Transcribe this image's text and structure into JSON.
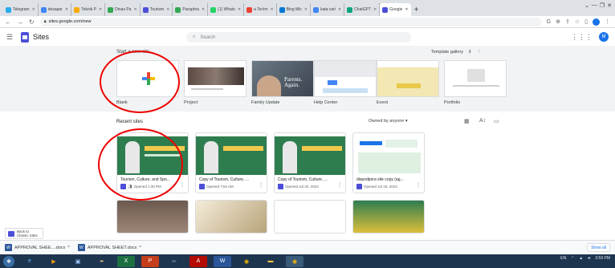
{
  "browser": {
    "tabs": [
      {
        "label": "Telegram",
        "color": "#2aabee"
      },
      {
        "label": "desapar",
        "color": "#4285f4"
      },
      {
        "label": "Teknik P",
        "color": "#f9ab00"
      },
      {
        "label": "Dinas Pa",
        "color": "#34a853"
      },
      {
        "label": "Tourism",
        "color": "#4c4ed8"
      },
      {
        "label": "Paraphra",
        "color": "#34a853"
      },
      {
        "label": "(1) Whats",
        "color": "#25d366"
      },
      {
        "label": "a Techn",
        "color": "#ea4335"
      },
      {
        "label": "Bing Mic",
        "color": "#0078d4"
      },
      {
        "label": "kata vari",
        "color": "#4285f4"
      },
      {
        "label": "ChatGPT",
        "color": "#10a37f"
      },
      {
        "label": "Google",
        "color": "#4c4ed8",
        "active": true
      }
    ],
    "url": "sites.google.com/new"
  },
  "header": {
    "app_title": "Sites",
    "search_placeholder": "Search",
    "avatar_letter": "M"
  },
  "templates": {
    "heading": "Start a new site",
    "gallery_label": "Template gallery",
    "items": [
      {
        "label": "Blank"
      },
      {
        "label": "Project"
      },
      {
        "label": "Family Update",
        "thumb_text": "Parents. Again."
      },
      {
        "label": "Help Center"
      },
      {
        "label": "Event"
      },
      {
        "label": "Portfolio"
      }
    ]
  },
  "recent": {
    "heading": "Recent sites",
    "owner_filter": "Owned by anyone",
    "sites": [
      {
        "title": "Tourism, Culture, and Spo...",
        "meta": "Opened 1:30 PM"
      },
      {
        "title": "Copy of Tourism, Culture, ...",
        "meta": "Opened 7:54 AM"
      },
      {
        "title": "Copy of Tourism, Culture, ...",
        "meta": "Opened Jul 20, 2023"
      },
      {
        "title": "dispodpora site copy (ag...",
        "meta": "Opened Jul 19, 2023"
      }
    ]
  },
  "classic_sites": {
    "line1": "Back to",
    "line2": "Classic Sites"
  },
  "downloads": {
    "items": [
      "APPROVAL SHEE....docx",
      "APPROVAL SHEET.docx"
    ],
    "show_all": "Show all"
  },
  "taskbar": {
    "tray_text": "EN",
    "clock": "3:59 PM"
  },
  "colors": {
    "sites_brand": "#4c4ed8",
    "annotation_red": "#ee0000",
    "taskbar": "#1e3550"
  }
}
